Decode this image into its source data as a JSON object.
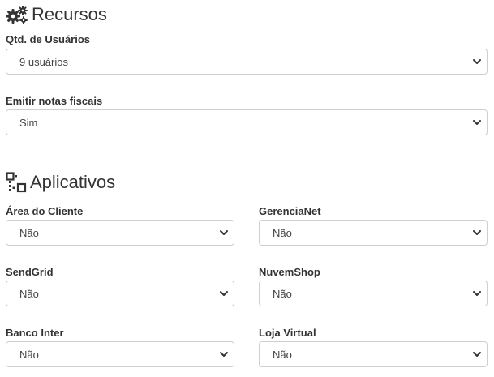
{
  "recursos": {
    "title": "Recursos",
    "icon": "gears-icon",
    "fields": [
      {
        "label": "Qtd. de Usuários",
        "value": "9 usuários"
      },
      {
        "label": "Emitir notas fiscais",
        "value": "Sim"
      }
    ]
  },
  "aplicativos": {
    "title": "Aplicativos",
    "icon": "sitemap-icon",
    "fields": [
      {
        "label": "Área do Cliente",
        "value": "Não"
      },
      {
        "label": "GerenciaNet",
        "value": "Não"
      },
      {
        "label": "SendGrid",
        "value": "Não"
      },
      {
        "label": "NuvemShop",
        "value": "Não"
      },
      {
        "label": "Banco Inter",
        "value": "Não"
      },
      {
        "label": "Loja Virtual",
        "value": "Não"
      }
    ]
  }
}
